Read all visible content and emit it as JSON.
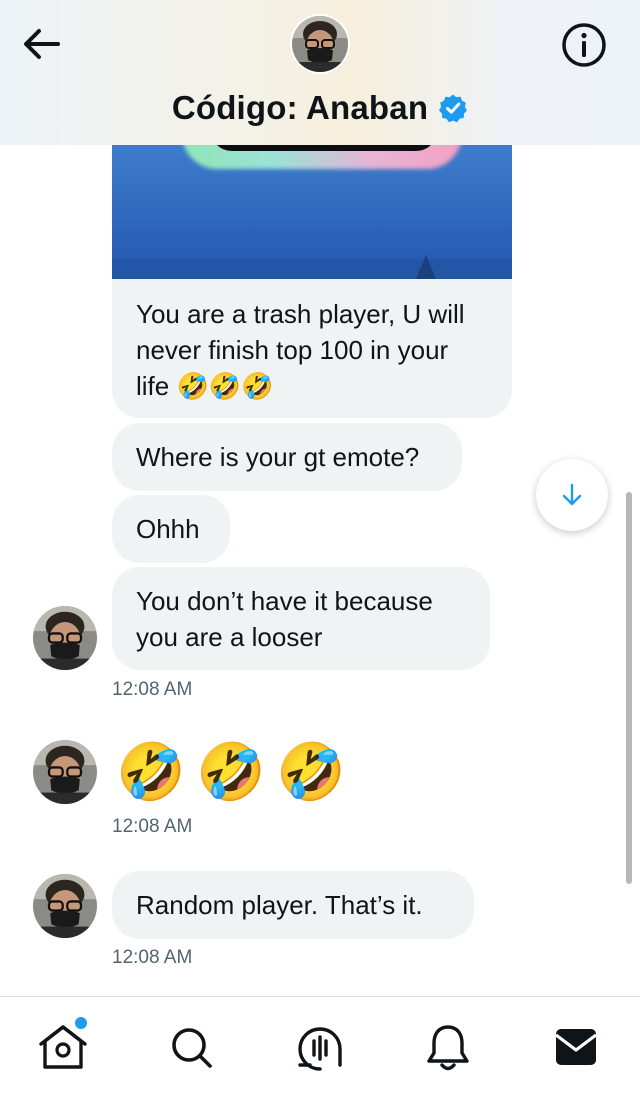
{
  "header": {
    "title": "Código: Anaban",
    "verified_color": "#1d9bf0",
    "icons": [
      "back-arrow-icon",
      "info-icon",
      "verified-badge-icon"
    ]
  },
  "messages": [
    {
      "text": "You are a trash player, U will never finish top 100 in your life",
      "emoji": "🤣🤣🤣"
    },
    {
      "text": "Where is your gt emote?"
    },
    {
      "text": "Ohhh"
    },
    {
      "text": "You don’t have it because you are a looser"
    }
  ],
  "timestamps": [
    "12:08 AM",
    "12:08 AM",
    "12:08 AM"
  ],
  "emoji_message": [
    "🤣",
    "🤣",
    "🤣"
  ],
  "last_message": "Random player. That’s it.",
  "scroll_button": {
    "icon": "arrow-down-icon"
  },
  "tabbar": {
    "items": [
      "home-icon",
      "search-icon",
      "spaces-icon",
      "notifications-icon",
      "messages-icon"
    ],
    "active": "messages-icon",
    "notification_dot_color": "#1d9bf0"
  }
}
